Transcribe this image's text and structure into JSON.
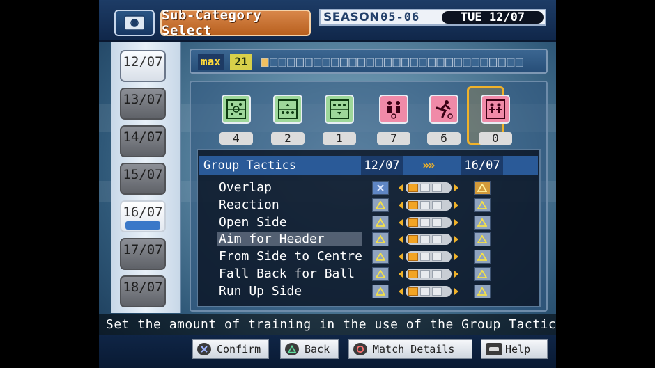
{
  "header": {
    "subcategory_label": "Sub-Category Select",
    "season_label": "SEASON",
    "season_value": "05-06",
    "current_date": "TUE 12/07"
  },
  "dates": [
    {
      "label": "12/07",
      "state": "normal"
    },
    {
      "label": "13/07",
      "state": "dim"
    },
    {
      "label": "14/07",
      "state": "dim"
    },
    {
      "label": "15/07",
      "state": "dim"
    },
    {
      "label": "16/07",
      "state": "selected"
    },
    {
      "label": "17/07",
      "state": "dim"
    },
    {
      "label": "18/07",
      "state": "dim"
    }
  ],
  "max_bar": {
    "label": "max",
    "value": "21",
    "slot_count": 30,
    "filled": 1
  },
  "categories": [
    {
      "icon": "formation-icon",
      "color": "green",
      "count": "4"
    },
    {
      "icon": "formation-attack-icon",
      "color": "green",
      "count": "2"
    },
    {
      "icon": "formation-defence-icon",
      "color": "green",
      "count": "1"
    },
    {
      "icon": "group-tactics-icon",
      "color": "pink",
      "count": "7",
      "selected": true
    },
    {
      "icon": "running-player-icon",
      "color": "pink",
      "count": "6"
    },
    {
      "icon": "pair-players-icon",
      "color": "pink",
      "count": "0"
    }
  ],
  "table": {
    "title": "Group Tactics",
    "from_date": "12/07",
    "arrow": "»»",
    "to_date": "16/07",
    "rows": [
      {
        "name": "Overlap",
        "current": "x",
        "level": 1,
        "new_highlight": true,
        "highlighted": false
      },
      {
        "name": "Reaction",
        "current": "triangle",
        "level": 1,
        "new_highlight": false,
        "highlighted": false
      },
      {
        "name": "Open Side",
        "current": "triangle",
        "level": 1,
        "new_highlight": false,
        "highlighted": false
      },
      {
        "name": "Aim for Header",
        "current": "triangle",
        "level": 1,
        "new_highlight": false,
        "highlighted": true
      },
      {
        "name": "From Side to Centre",
        "current": "triangle",
        "level": 1,
        "new_highlight": false,
        "highlighted": false
      },
      {
        "name": "Fall Back for Ball",
        "current": "triangle",
        "level": 1,
        "new_highlight": false,
        "highlighted": false
      },
      {
        "name": "Run Up Side",
        "current": "triangle",
        "level": 1,
        "new_highlight": false,
        "highlighted": false
      }
    ]
  },
  "help_text": "Set the amount of training in the use of the Group Tactics",
  "footer": {
    "confirm": "Confirm",
    "back": "Back",
    "match_details": "Match Details",
    "help": "Help"
  },
  "colors": {
    "accent": "#f0b22a",
    "subcategory_bg": "#c8702f",
    "header_bar": "#2a5a98"
  }
}
